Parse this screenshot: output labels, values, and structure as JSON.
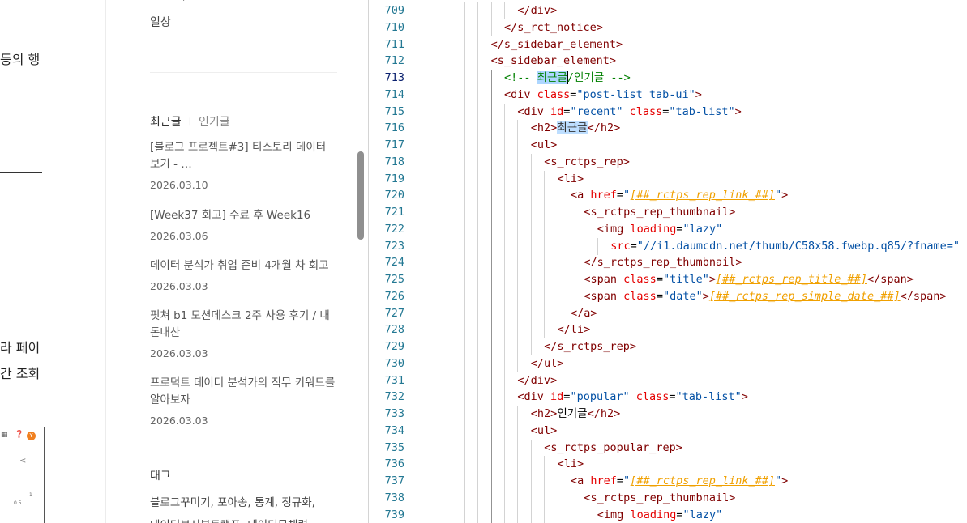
{
  "preview": {
    "left_fragments": [
      "등의 행",
      "라 페이",
      "간 조회"
    ],
    "thumb": {
      "avatar_letter": "Y",
      "value_1": "1",
      "value_2": "0.5"
    },
    "category_item": "일상",
    "tabs": {
      "recent": "최근글",
      "separator": "|",
      "popular": "인기글"
    },
    "posts": [
      {
        "title": "[블로그 프로젝트#3] 티스토리 데이터 보기 - …",
        "date": "2026.03.10"
      },
      {
        "title": "[Week37 회고] 수료 후 Week16",
        "date": "2026.03.06"
      },
      {
        "title": "데이터 분석가 취업 준비 4개월 차 회고",
        "date": "2026.03.03"
      },
      {
        "title": "핏쳐 b1 모션데스크 2주 사용 후기 / 내돈내산",
        "date": "2026.03.03"
      },
      {
        "title": "프로덕트 데이터 분석가의 직무 키워드를 알아보자",
        "date": "2026.03.03"
      }
    ],
    "tags_title": "태그",
    "tags_line_1": "블로그꾸미기,  포아송,  통계,  정규화,",
    "tags_line_2": "데이터보서부트캠프,  데이터무체력"
  },
  "editor": {
    "current_line": 713,
    "lines": [
      {
        "n": 709,
        "indent": 12,
        "parts": [
          [
            "tag",
            "</div>"
          ]
        ]
      },
      {
        "n": 710,
        "indent": 10,
        "parts": [
          [
            "tag",
            "</s_rct_notice>"
          ]
        ]
      },
      {
        "n": 711,
        "indent": 8,
        "parts": [
          [
            "tag",
            "</s_sidebar_element>"
          ]
        ]
      },
      {
        "n": 712,
        "indent": 8,
        "parts": [
          [
            "tag",
            "<s_sidebar_element>"
          ]
        ]
      },
      {
        "n": 713,
        "indent": 10,
        "parts": [
          [
            "cmt",
            "<!-- "
          ],
          [
            "hl",
            "최근글"
          ],
          [
            "caret",
            ""
          ],
          [
            "cmt",
            "/인기글 -->"
          ]
        ]
      },
      {
        "n": 714,
        "indent": 10,
        "parts": [
          [
            "tag",
            "<div "
          ],
          [
            "attr",
            "class"
          ],
          [
            "txt",
            "="
          ],
          [
            "str",
            "\"post-list tab-ui\""
          ],
          [
            "tag",
            ">"
          ]
        ]
      },
      {
        "n": 715,
        "indent": 12,
        "parts": [
          [
            "tag",
            "<div "
          ],
          [
            "attr",
            "id"
          ],
          [
            "txt",
            "="
          ],
          [
            "str",
            "\"recent\""
          ],
          [
            "txt",
            " "
          ],
          [
            "attr",
            "class"
          ],
          [
            "txt",
            "="
          ],
          [
            "str",
            "\"tab-list\""
          ],
          [
            "tag",
            ">"
          ]
        ]
      },
      {
        "n": 716,
        "indent": 14,
        "parts": [
          [
            "tag",
            "<h2>"
          ],
          [
            "hl2",
            "최근글"
          ],
          [
            "tag",
            "</h2>"
          ]
        ]
      },
      {
        "n": 717,
        "indent": 14,
        "parts": [
          [
            "tag",
            "<ul>"
          ]
        ]
      },
      {
        "n": 718,
        "indent": 16,
        "parts": [
          [
            "tag",
            "<s_rctps_rep>"
          ]
        ]
      },
      {
        "n": 719,
        "indent": 18,
        "parts": [
          [
            "tag",
            "<li>"
          ]
        ]
      },
      {
        "n": 720,
        "indent": 20,
        "parts": [
          [
            "tag",
            "<a "
          ],
          [
            "attr",
            "href"
          ],
          [
            "txt",
            "="
          ],
          [
            "str",
            "\""
          ],
          [
            "tpl",
            "[##_rctps_rep_link_##]"
          ],
          [
            "str",
            "\""
          ],
          [
            "tag",
            ">"
          ]
        ]
      },
      {
        "n": 721,
        "indent": 22,
        "parts": [
          [
            "tag",
            "<s_rctps_rep_thumbnail>"
          ]
        ]
      },
      {
        "n": 722,
        "indent": 24,
        "parts": [
          [
            "tag",
            "<img "
          ],
          [
            "attr",
            "loading"
          ],
          [
            "txt",
            "="
          ],
          [
            "str",
            "\"lazy\""
          ]
        ]
      },
      {
        "n": 723,
        "indent": 26,
        "parts": [
          [
            "attr",
            "src"
          ],
          [
            "txt",
            "="
          ],
          [
            "str",
            "\"//i1.daumcdn.net/thumb/C58x58.fwebp.q85/?fname=\""
          ]
        ]
      },
      {
        "n": 724,
        "indent": 22,
        "parts": [
          [
            "tag",
            "</s_rctps_rep_thumbnail>"
          ]
        ]
      },
      {
        "n": 725,
        "indent": 22,
        "parts": [
          [
            "tag",
            "<span "
          ],
          [
            "attr",
            "class"
          ],
          [
            "txt",
            "="
          ],
          [
            "str",
            "\"title\""
          ],
          [
            "tag",
            ">"
          ],
          [
            "tpl",
            "[##_rctps_rep_title_##]"
          ],
          [
            "tag",
            "</span>"
          ]
        ]
      },
      {
        "n": 726,
        "indent": 22,
        "parts": [
          [
            "tag",
            "<span "
          ],
          [
            "attr",
            "class"
          ],
          [
            "txt",
            "="
          ],
          [
            "str",
            "\"date\""
          ],
          [
            "tag",
            ">"
          ],
          [
            "tpl",
            "[##_rctps_rep_simple_date_##]"
          ],
          [
            "tag",
            "</span>"
          ]
        ]
      },
      {
        "n": 727,
        "indent": 20,
        "parts": [
          [
            "tag",
            "</a>"
          ]
        ]
      },
      {
        "n": 728,
        "indent": 18,
        "parts": [
          [
            "tag",
            "</li>"
          ]
        ]
      },
      {
        "n": 729,
        "indent": 16,
        "parts": [
          [
            "tag",
            "</s_rctps_rep>"
          ]
        ]
      },
      {
        "n": 730,
        "indent": 14,
        "parts": [
          [
            "tag",
            "</ul>"
          ]
        ]
      },
      {
        "n": 731,
        "indent": 12,
        "parts": [
          [
            "tag",
            "</div>"
          ]
        ]
      },
      {
        "n": 732,
        "indent": 12,
        "parts": [
          [
            "tag",
            "<div "
          ],
          [
            "attr",
            "id"
          ],
          [
            "txt",
            "="
          ],
          [
            "str",
            "\"popular\""
          ],
          [
            "txt",
            " "
          ],
          [
            "attr",
            "class"
          ],
          [
            "txt",
            "="
          ],
          [
            "str",
            "\"tab-list\""
          ],
          [
            "tag",
            ">"
          ]
        ]
      },
      {
        "n": 733,
        "indent": 14,
        "parts": [
          [
            "tag",
            "<h2>"
          ],
          [
            "txt",
            "인기글"
          ],
          [
            "tag",
            "</h2>"
          ]
        ]
      },
      {
        "n": 734,
        "indent": 14,
        "parts": [
          [
            "tag",
            "<ul>"
          ]
        ]
      },
      {
        "n": 735,
        "indent": 16,
        "parts": [
          [
            "tag",
            "<s_rctps_popular_rep>"
          ]
        ]
      },
      {
        "n": 736,
        "indent": 18,
        "parts": [
          [
            "tag",
            "<li>"
          ]
        ]
      },
      {
        "n": 737,
        "indent": 20,
        "parts": [
          [
            "tag",
            "<a "
          ],
          [
            "attr",
            "href"
          ],
          [
            "txt",
            "="
          ],
          [
            "str",
            "\""
          ],
          [
            "tpl",
            "[##_rctps_rep_link_##]"
          ],
          [
            "str",
            "\""
          ],
          [
            "tag",
            ">"
          ]
        ]
      },
      {
        "n": 738,
        "indent": 22,
        "parts": [
          [
            "tag",
            "<s_rctps_rep_thumbnail>"
          ]
        ]
      },
      {
        "n": 739,
        "indent": 24,
        "parts": [
          [
            "tag",
            "<img "
          ],
          [
            "attr",
            "loading"
          ],
          [
            "txt",
            "="
          ],
          [
            "str",
            "\"lazy\""
          ]
        ]
      }
    ]
  }
}
